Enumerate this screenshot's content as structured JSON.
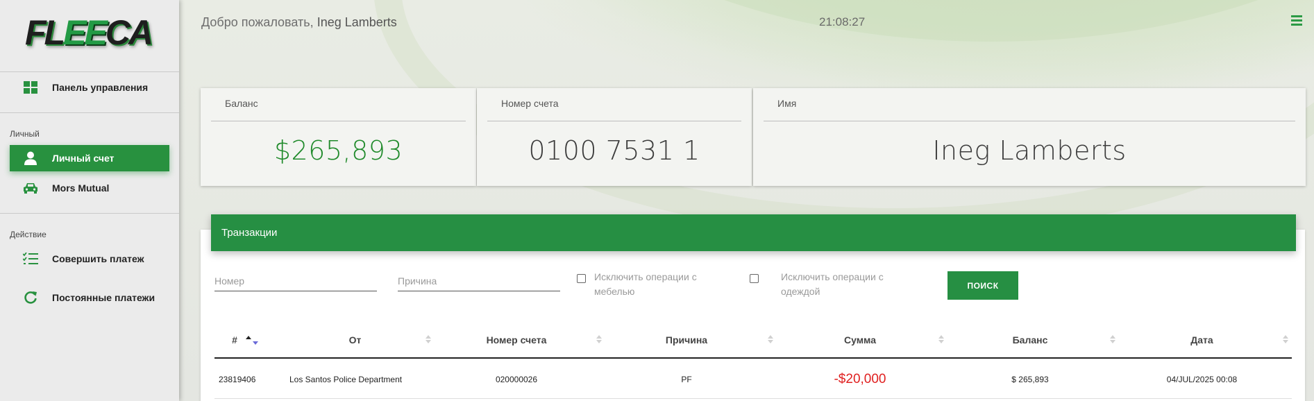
{
  "sidebar": {
    "logo": "FLEECA",
    "items": [
      {
        "label": "Панель управления",
        "icon": "dashboard-grid-icon"
      },
      {
        "label": "Личный счет",
        "icon": "user-icon",
        "active": true
      },
      {
        "label": "Mors Mutual",
        "icon": "car-icon"
      },
      {
        "label": "Совершить платеж",
        "icon": "checklist-icon"
      },
      {
        "label": "Постоянные платежи",
        "icon": "refresh-icon"
      }
    ],
    "sections": {
      "personal": "Личный",
      "action": "Действие"
    }
  },
  "header": {
    "welcome_prefix": "Добро пожаловать,",
    "user_name": "Ineg Lamberts",
    "time": "21:08:27"
  },
  "cards": {
    "balance": {
      "title": "Баланс",
      "value": "$265,893"
    },
    "account": {
      "title": "Номер счета",
      "value": "0100 7531 1"
    },
    "name": {
      "title": "Имя",
      "value": "Ineg Lamberts"
    }
  },
  "transactions": {
    "title": "Транзакции",
    "filters": {
      "number_placeholder": "Номер",
      "reason_placeholder": "Причина",
      "exclude_furniture_line1": "Исключить операции с",
      "exclude_furniture_line2": "мебелью",
      "exclude_clothing_line1": "Исключить операции с",
      "exclude_clothing_line2": "одеждой",
      "search_label": "ПОИСК"
    },
    "columns": [
      "#",
      "От",
      "Номер счета",
      "Причина",
      "Сумма",
      "Баланс",
      "Дата"
    ],
    "rows": [
      {
        "id": "23819406",
        "from": "Los Santos Police Department",
        "account": "020000026",
        "reason": "PF",
        "amount": "-$20,000",
        "balance": "$ 265,893",
        "date": "04/JUL/2025 00:08"
      }
    ]
  },
  "colors": {
    "accent": "#268f43",
    "negative": "#e02020",
    "balance_green": "#1f8a2a"
  }
}
